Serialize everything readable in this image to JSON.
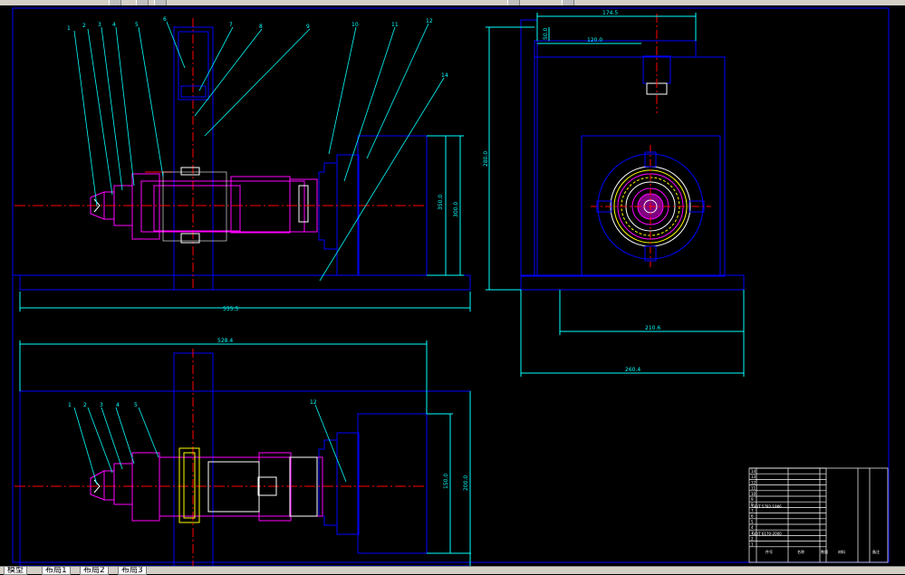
{
  "tabs": [
    "模型",
    "布局1",
    "布局2",
    "布局3"
  ],
  "callouts_main": [
    "1",
    "2",
    "3",
    "4",
    "5",
    "6",
    "7",
    "8",
    "9",
    "10",
    "11",
    "12",
    "14"
  ],
  "callouts_bottom": [
    "1",
    "2",
    "3",
    "4",
    "5",
    "12"
  ],
  "dimensions": {
    "main_width": "555.5",
    "main_height_a": "350.0",
    "main_height_b": "300.0",
    "side_top": "174.5",
    "side_top2": "120.0",
    "side_height": "280.0",
    "side_base": "210.6",
    "side_base_total": "260.4",
    "side_small": "50.0",
    "bottom_width": "528.4",
    "bottom_height_a": "150.0",
    "bottom_height_b": "200.0"
  },
  "title_block": {
    "rows": [
      "1",
      "2",
      "3",
      "4",
      "5",
      "6",
      "7",
      "8",
      "9",
      "10",
      "11",
      "12",
      "13",
      "14"
    ],
    "part_codes": [
      "GB/T 5782-1986",
      "GB/T 6170-2000"
    ],
    "footer": [
      "件号",
      "名称",
      "数量",
      "材料",
      "备注"
    ]
  },
  "colors": {
    "frame": "#0000ff",
    "leader": "#00ffff",
    "part": "#ff00ff",
    "centerline": "#ff0000",
    "text": "#ffffff",
    "dim": "#00ffff",
    "yellow": "#ffff00",
    "background": "#000000"
  }
}
